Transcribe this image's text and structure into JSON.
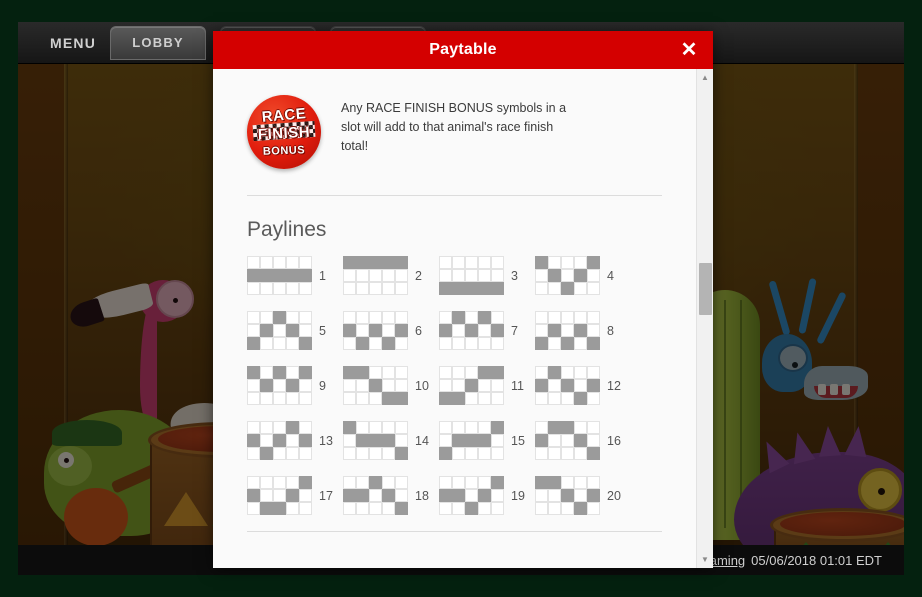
{
  "window": {
    "background_color": "#04210f"
  },
  "toolbar": {
    "menu_label": "MENU",
    "buttons": [
      {
        "label": "LOBBY",
        "style": "light"
      },
      {
        "label": "",
        "style": "dark"
      },
      {
        "label": "",
        "style": "dark"
      }
    ]
  },
  "statusbar": {
    "link_text": "aming",
    "text": "05/06/2018 01:01 EDT",
    "caret_icon": "chevron-down-icon"
  },
  "modal": {
    "title": "Paytable",
    "close_icon": "close-icon",
    "header_color": "#d40000",
    "bonus": {
      "badge": {
        "icon": "race-finish-bonus-icon",
        "line1": "RACE",
        "line2": "FINISH",
        "line3": "BONUS",
        "color": "#e01b0c"
      },
      "description": "Any RACE FINISH BONUS symbols in a slot will add to that animal's race finish total!"
    },
    "paylines_heading": "Paylines",
    "scrollbar": {
      "up_icon": "triangle-up-icon",
      "down_icon": "triangle-down-icon",
      "thumb_position_percent": 38
    }
  },
  "chart_data": {
    "type": "table",
    "title": "Paylines",
    "rows": 3,
    "columns": 5,
    "on_color": "#9b9b9b",
    "off_color": "#ffffff",
    "paylines": [
      {
        "number": "1",
        "rows": [
          1,
          1,
          1,
          1,
          1
        ]
      },
      {
        "number": "2",
        "rows": [
          0,
          0,
          0,
          0,
          0
        ]
      },
      {
        "number": "3",
        "rows": [
          2,
          2,
          2,
          2,
          2
        ]
      },
      {
        "number": "4",
        "rows": [
          0,
          1,
          2,
          1,
          0
        ]
      },
      {
        "number": "5",
        "rows": [
          2,
          1,
          0,
          1,
          2
        ]
      },
      {
        "number": "6",
        "rows": [
          1,
          2,
          1,
          2,
          1
        ]
      },
      {
        "number": "7",
        "rows": [
          1,
          0,
          1,
          0,
          1
        ]
      },
      {
        "number": "8",
        "rows": [
          2,
          1,
          2,
          1,
          2
        ]
      },
      {
        "number": "9",
        "rows": [
          0,
          1,
          0,
          1,
          0
        ]
      },
      {
        "number": "10",
        "rows": [
          0,
          0,
          1,
          2,
          2
        ]
      },
      {
        "number": "11",
        "rows": [
          2,
          2,
          1,
          0,
          0
        ]
      },
      {
        "number": "12",
        "rows": [
          1,
          0,
          1,
          2,
          1
        ]
      },
      {
        "number": "13",
        "rows": [
          1,
          2,
          1,
          0,
          1
        ]
      },
      {
        "number": "14",
        "rows": [
          0,
          1,
          1,
          1,
          2
        ]
      },
      {
        "number": "15",
        "rows": [
          2,
          1,
          1,
          1,
          0
        ]
      },
      {
        "number": "16",
        "rows": [
          1,
          0,
          0,
          1,
          2
        ]
      },
      {
        "number": "17",
        "rows": [
          1,
          2,
          2,
          1,
          0
        ]
      },
      {
        "number": "18",
        "rows": [
          1,
          1,
          0,
          1,
          2
        ]
      },
      {
        "number": "19",
        "rows": [
          1,
          1,
          2,
          1,
          0
        ]
      },
      {
        "number": "20",
        "rows": [
          0,
          0,
          1,
          2,
          1
        ]
      }
    ]
  }
}
